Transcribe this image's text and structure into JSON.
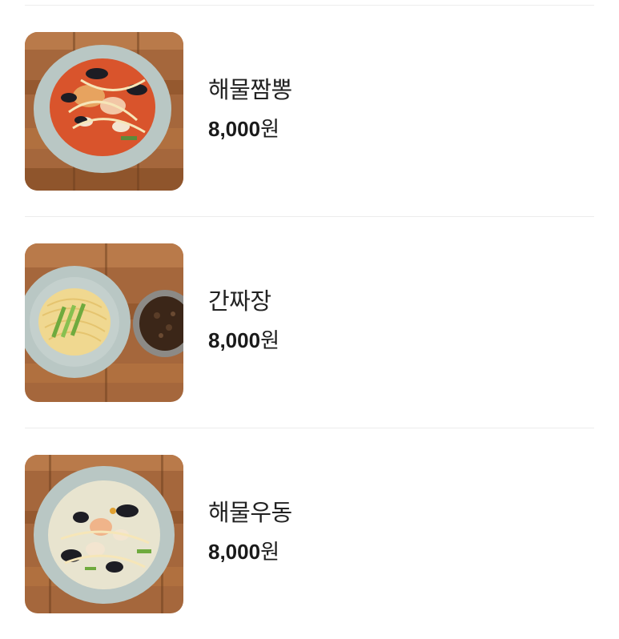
{
  "menu": {
    "items": [
      {
        "name": "해물짬뽕",
        "price": "8,000",
        "unit": "원",
        "photo_icon": "jjamppong-bowl-photo"
      },
      {
        "name": "간짜장",
        "price": "8,000",
        "unit": "원",
        "photo_icon": "ganjjajang-plate-photo"
      },
      {
        "name": "해물우동",
        "price": "8,000",
        "unit": "원",
        "photo_icon": "seafood-udon-bowl-photo"
      }
    ]
  },
  "colors": {
    "divider": "#ececec",
    "text": "#222222",
    "wood": "#a5673c",
    "bowl": "#b9c7c4",
    "spicy_broth": "#d9542c",
    "clear_broth": "#e8e4cf",
    "noodle": "#f0d890",
    "black_bean_sauce": "#3b2618"
  }
}
